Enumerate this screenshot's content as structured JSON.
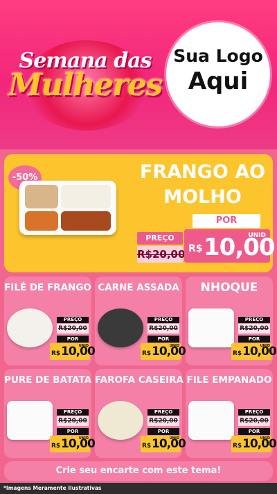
{
  "header": {
    "brand_line1": "Semana das",
    "brand_line2": "Mulheres",
    "logo_line1": "Sua Logo",
    "logo_line2": "Aqui"
  },
  "feature": {
    "badge": "-50%",
    "title_line1": "FRANGO AO",
    "title_line2": "MOLHO",
    "preco_label": "PREÇO",
    "old_price": "R$20,00",
    "por_label": "POR",
    "currency": "R$",
    "price": "10,00",
    "unid": "UNID"
  },
  "cards": [
    {
      "title": "FILÉ DE FRANGO",
      "preco_label": "PREÇO",
      "old_price": "R$20,00",
      "por_label": "POR",
      "currency": "R$",
      "price": "10,00",
      "unid": "UNID"
    },
    {
      "title": "CARNE ASSADA",
      "preco_label": "PREÇO",
      "old_price": "R$20,00",
      "por_label": "POR",
      "currency": "R$",
      "price": "10,00",
      "unid": "UNID"
    },
    {
      "title": "NHOQUE",
      "preco_label": "PREÇO",
      "old_price": "R$20,00",
      "por_label": "POR",
      "currency": "R$",
      "price": "10,00",
      "unid": "UNID"
    },
    {
      "title": "PURE DE BATATA",
      "preco_label": "PREÇO",
      "old_price": "R$20,00",
      "por_label": "POR",
      "currency": "R$",
      "price": "10,00",
      "unid": "UNID"
    },
    {
      "title": "FAROFA CASEIRA",
      "preco_label": "PREÇO",
      "old_price": "R$20,00",
      "por_label": "POR",
      "currency": "R$",
      "price": "10,00",
      "unid": "UNID"
    },
    {
      "title": "FILE EMPANADO",
      "preco_label": "PREÇO",
      "old_price": "R$20,00",
      "por_label": "POR",
      "currency": "R$",
      "price": "10,00",
      "unid": "UNID"
    }
  ],
  "cta": "Crie seu encarte com este tema!",
  "footer_note": "*Imagens Meramente Ilustrativas",
  "colors": {
    "header_pink": "#f2267a",
    "background_pink": "#f0668f",
    "card_pink": "#f480a8",
    "feature_yellow": "#fdc52d",
    "price_yellow": "#fdc52d"
  }
}
